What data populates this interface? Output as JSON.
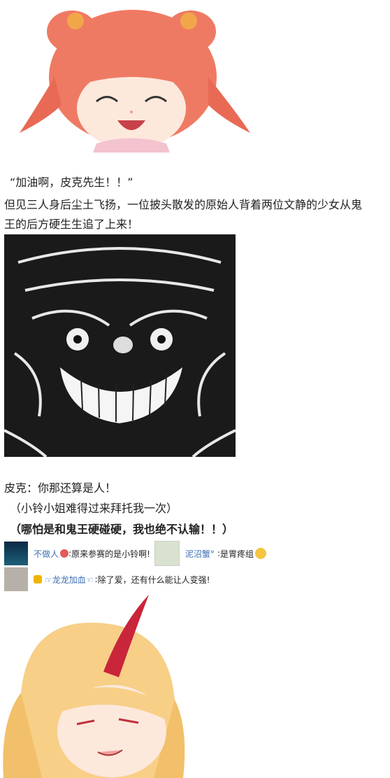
{
  "story": {
    "p1": "“加油啊，皮克先生！！”",
    "p2a": "但见三人身后尘土飞扬，一位披头散发的原始人背着两位文静的少女从鬼",
    "p2b": "王的后方硬生生追了上来！",
    "p3": "皮克：你那还算是人！",
    "p4": "（小铃小姐难得过来拜托我一次）",
    "p5": "（哪怕是和鬼王硬碰硬，我也绝不认输！！）"
  },
  "comments": [
    {
      "user": "不做人",
      "sep": ":",
      "text": "原来参赛的是小铃啊!"
    },
    {
      "user": "泥沼蟹°",
      "sep": ":",
      "text": "是胃疼组"
    },
    {
      "user": "☞龙龙加血☜",
      "sep": ":",
      "text": "除了爱，还有什么能让人变强!"
    }
  ],
  "colors": {
    "link": "#3a6fb5",
    "hair_red": "#ee6f5a",
    "hair_blonde": "#f7c97a",
    "horn": "#c9253b"
  }
}
